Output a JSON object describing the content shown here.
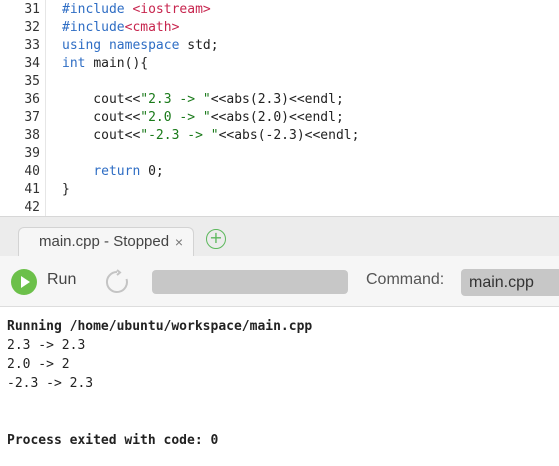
{
  "editor": {
    "lines": [
      {
        "num": "31",
        "parts": [
          {
            "cls": "kw",
            "text": "#include "
          },
          {
            "cls": "inc",
            "text": "<iostream>"
          }
        ]
      },
      {
        "num": "32",
        "parts": [
          {
            "cls": "kw",
            "text": "#include"
          },
          {
            "cls": "inc",
            "text": "<cmath>"
          }
        ]
      },
      {
        "num": "33",
        "parts": [
          {
            "cls": "kw",
            "text": "using "
          },
          {
            "cls": "kw",
            "text": "namespace "
          },
          {
            "cls": "",
            "text": "std;"
          }
        ]
      },
      {
        "num": "34",
        "parts": [
          {
            "cls": "kw",
            "text": "int "
          },
          {
            "cls": "",
            "text": "main(){"
          }
        ]
      },
      {
        "num": "35",
        "parts": []
      },
      {
        "num": "36",
        "parts": [
          {
            "cls": "",
            "text": "    cout<<"
          },
          {
            "cls": "str",
            "text": "\"2.3 -> \""
          },
          {
            "cls": "",
            "text": "<<abs(2.3)<<endl;"
          }
        ]
      },
      {
        "num": "37",
        "parts": [
          {
            "cls": "",
            "text": "    cout<<"
          },
          {
            "cls": "str",
            "text": "\"2.0 -> \""
          },
          {
            "cls": "",
            "text": "<<abs(2.0)<<endl;"
          }
        ]
      },
      {
        "num": "38",
        "parts": [
          {
            "cls": "",
            "text": "    cout<<"
          },
          {
            "cls": "str",
            "text": "\"-2.3 -> \""
          },
          {
            "cls": "",
            "text": "<<abs(-2.3)<<endl;"
          }
        ]
      },
      {
        "num": "39",
        "parts": []
      },
      {
        "num": "40",
        "parts": [
          {
            "cls": "",
            "text": "    "
          },
          {
            "cls": "kw",
            "text": "return "
          },
          {
            "cls": "",
            "text": "0;"
          }
        ]
      },
      {
        "num": "41",
        "parts": [
          {
            "cls": "",
            "text": "}"
          }
        ]
      },
      {
        "num": "42",
        "parts": []
      }
    ]
  },
  "tabs": {
    "active_label": "main.cpp - Stopped",
    "close_glyph": "×",
    "add_glyph": "+"
  },
  "toolbar": {
    "run_label": "Run",
    "command_label": "Command:",
    "command_value": "main.cpp",
    "run_color": "#6cc04a"
  },
  "console": {
    "lines": [
      {
        "text": "Running /home/ubuntu/workspace/main.cpp",
        "bold": true
      },
      {
        "text": "2.3 -> 2.3",
        "bold": false
      },
      {
        "text": "2.0 -> 2",
        "bold": false
      },
      {
        "text": "-2.3 -> 2.3",
        "bold": false
      },
      {
        "text": "",
        "bold": false
      },
      {
        "text": "",
        "bold": false
      },
      {
        "text": "Process exited with code: 0",
        "bold": true
      }
    ]
  },
  "icons": {
    "run": "play-icon",
    "restart": "restart-icon",
    "close": "close-icon",
    "add": "add-tab-icon"
  }
}
